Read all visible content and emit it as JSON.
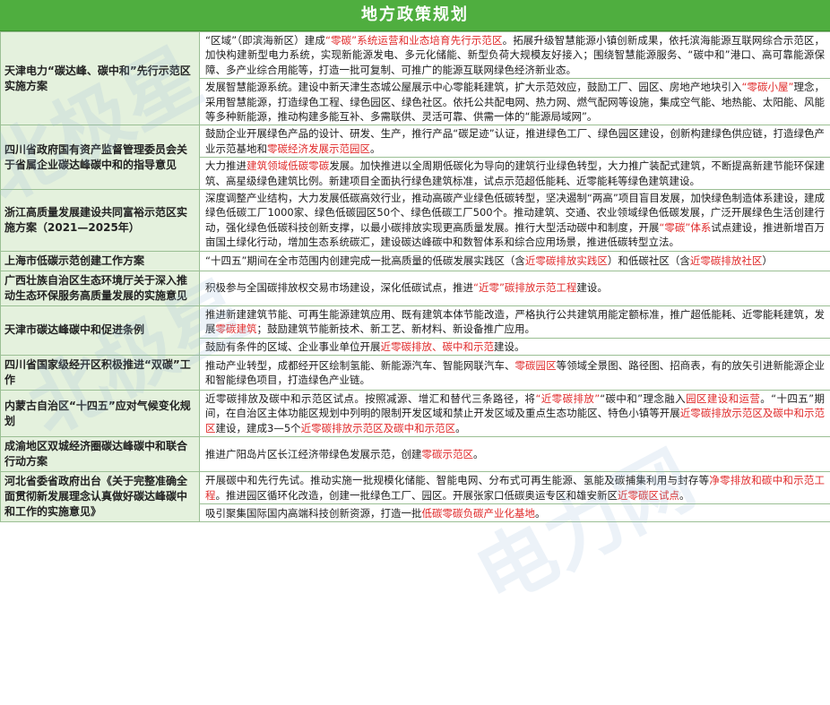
{
  "title": "地方政策规划",
  "rows": [
    {
      "name": "天津电力“碳达峰、碳中和”先行示范区实施方案",
      "paras": [
        [
          [
            "“区域”（即滨海新区）建成",
            0
          ],
          [
            "“零碳”系统运营和业态培育先行示范区",
            1
          ],
          [
            "。拓展升级智慧能源小镇创新成果，依托滨海能源互联网综合示范区，加快构建新型电力系统，实现新能源发电、多元化储能、新型负荷大规模友好接入；围绕智慧能源服务、“碳中和”港口、高可靠能源保障、多产业综合用能等，打造一批可复制、可推广的能源互联网绿色经济新业态。",
            0
          ]
        ],
        [
          [
            "发展智慧能源系统。建设中新天津生态城公屋展示中心零能耗建筑，扩大示范效应，鼓励工厂、园区、房地产地块引入",
            0
          ],
          [
            "“零碳小屋”",
            1
          ],
          [
            "理念，采用智慧能源，打造绿色工程、绿色园区、绿色社区。依托公共配电网、热力网、燃气配网等设施，集成空气能、地热能、太阳能、风能等多种新能源，推动构建多能互补、多需联供、灵活可靠、供需一体的“能源局域网”。",
            0
          ]
        ]
      ]
    },
    {
      "name": "四川省政府国有资产监督管理委员会关于省属企业碳达峰碳中和的指导意见",
      "paras": [
        [
          [
            "鼓励企业开展绿色产品的设计、研发、生产，推行产品“碳足迹”认证，推进绿色工厂、绿色园区建设，创新构建绿色供应链，打造绿色产业示范基地和",
            0
          ],
          [
            "零碳经济发展示范园区",
            1
          ],
          [
            "。",
            0
          ]
        ],
        [
          [
            "大力推进",
            0
          ],
          [
            "建筑领域低碳零碳",
            1
          ],
          [
            "发展。加快推进以全周期低碳化为导向的建筑行业绿色转型，大力推广装配式建筑，不断提高新建节能环保建筑、高星级绿色建筑比例。新建项目全面执行绿色建筑标准，试点示范超低能耗、近零能耗等绿色建筑建设。",
            0
          ]
        ]
      ]
    },
    {
      "name": "浙江高质量发展建设共同富裕示范区实施方案（2021—2025年）",
      "paras": [
        [
          [
            "深度调整产业结构，大力发展低碳高效行业，推动高碳产业绿色低碳转型，坚决遏制“两高”项目盲目发展，加快绿色制造体系建设，建成绿色低碳工厂1000家、绿色低碳园区50个、绿色低碳工厂500个。推动建筑、交通、农业领域绿色低碳发展，广泛开展绿色生活创建行动，强化绿色低碳科技创新支撑，以最小碳排放实现更高质量发展。推行大型活动碳中和制度，开展",
            0
          ],
          [
            "“零碳”体系",
            1
          ],
          [
            "试点建设，推进新增百万亩国土绿化行动，增加生态系统碳汇，建设碳达峰碳中和数智体系和综合应用场景，推进低碳转型立法。",
            0
          ]
        ]
      ]
    },
    {
      "name": "上海市低碳示范创建工作方案",
      "paras": [
        [
          [
            "“十四五”期间在全市范围内创建完成一批高质量的低碳发展实践区（含",
            0
          ],
          [
            "近零碳排放实践区",
            1
          ],
          [
            "）和低碳社区（含",
            0
          ],
          [
            "近零碳排放社区",
            1
          ],
          [
            "）",
            0
          ]
        ]
      ]
    },
    {
      "name": "广西壮族自治区生态环境厅关于深入推动生态环保服务高质量发展的实施意见",
      "paras": [
        [
          [
            "积极参与全国碳排放权交易市场建设，深化低碳试点，推进",
            0
          ],
          [
            "“近零”碳排放示范工程",
            1
          ],
          [
            "建设。",
            0
          ]
        ]
      ]
    },
    {
      "name": "天津市碳达峰碳中和促进条例",
      "paras": [
        [
          [
            "推进新建建筑节能、可再生能源建筑应用、既有建筑本体节能改造，严格执行公共建筑用能定额标准，推广超低能耗、近零能耗建筑，发展",
            0
          ],
          [
            "零碳建筑",
            1
          ],
          [
            "；鼓励建筑节能新技术、新工艺、新材料、新设备推广应用。",
            0
          ]
        ],
        [
          [
            "鼓励有条件的区域、企业事业单位开展",
            0
          ],
          [
            "近零碳排放、碳中和示范",
            1
          ],
          [
            "建设。",
            0
          ]
        ]
      ]
    },
    {
      "name": "四川省国家级经开区积极推进“双碳”工作",
      "paras": [
        [
          [
            "推动产业转型，成都经开区绘制氢能、新能源汽车、智能网联汽车、",
            0
          ],
          [
            "零碳园区",
            1
          ],
          [
            "等领域全景图、路径图、招商表，有的放矢引进新能源企业和智能绿色项目，打造绿色产业链。",
            0
          ]
        ]
      ]
    },
    {
      "name": "内蒙古自治区“十四五”应对气候变化规划",
      "paras": [
        [
          [
            "近零碳排放及碳中和示范区试点。按照减源、增汇和替代三条路径，将",
            0
          ],
          [
            "“近零碳排放”",
            1
          ],
          [
            "“碳中和”理念融入",
            0
          ],
          [
            "园区建设和运营",
            1
          ],
          [
            "。“十四五”期间，在自治区主体功能区规划中列明的限制开发区域和禁止开发区域及重点生态功能区、特色小镇等开展",
            0
          ],
          [
            "近零碳排放示范区及碳中和示范区",
            1
          ],
          [
            "建设，建成3—5个",
            0
          ],
          [
            "近零碳排放示范区及碳中和示范区",
            1
          ],
          [
            "。",
            0
          ]
        ]
      ]
    },
    {
      "name": "成渝地区双城经济圈碳达峰碳中和联合行动方案",
      "paras": [
        [
          [
            "推进广阳岛片区长江经济带绿色发展示范，创建",
            0
          ],
          [
            "零碳示范区",
            1
          ],
          [
            "。",
            0
          ]
        ]
      ]
    },
    {
      "name": "河北省委省政府出台《关于完整准确全面贯彻新发展理念认真做好碳达峰碳中和工作的实施意见》",
      "paras": [
        [
          [
            "开展碳中和先行先试。推动实施一批规模化储能、智能电网、分布式可再生能源、氢能及碳捕集利用与封存等",
            0
          ],
          [
            "净零排放和碳中和示范工程",
            1
          ],
          [
            "。推进园区循环化改造，创建一批绿色工厂、园区。开展张家口低碳奥运专区和雄安新区",
            0
          ],
          [
            "近零碳区试点",
            1
          ],
          [
            "。",
            0
          ]
        ],
        [
          [
            "吸引聚集国际国内高端科技创新资源，打造一批",
            0
          ],
          [
            "低碳零碳负碳产业化基地",
            1
          ],
          [
            "。",
            0
          ]
        ]
      ]
    }
  ]
}
